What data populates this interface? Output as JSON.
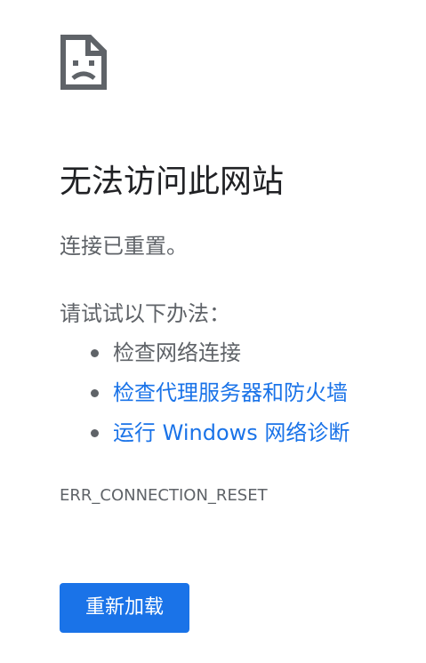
{
  "icon": "sad-page-icon",
  "title": "无法访问此网站",
  "subtitle": "连接已重置。",
  "suggestions": {
    "heading": "请试试以下办法：",
    "items": [
      {
        "label": "检查网络连接",
        "link": false
      },
      {
        "label": "检查代理服务器和防火墙",
        "link": true
      },
      {
        "label": "运行 Windows 网络诊断",
        "link": true
      }
    ]
  },
  "error_code": "ERR_CONNECTION_RESET",
  "reload_button": {
    "label": "重新加载"
  },
  "colors": {
    "link": "#1a73e8",
    "button_bg": "#1a73e8",
    "text_primary": "#202124",
    "text_secondary": "#5f6368"
  }
}
